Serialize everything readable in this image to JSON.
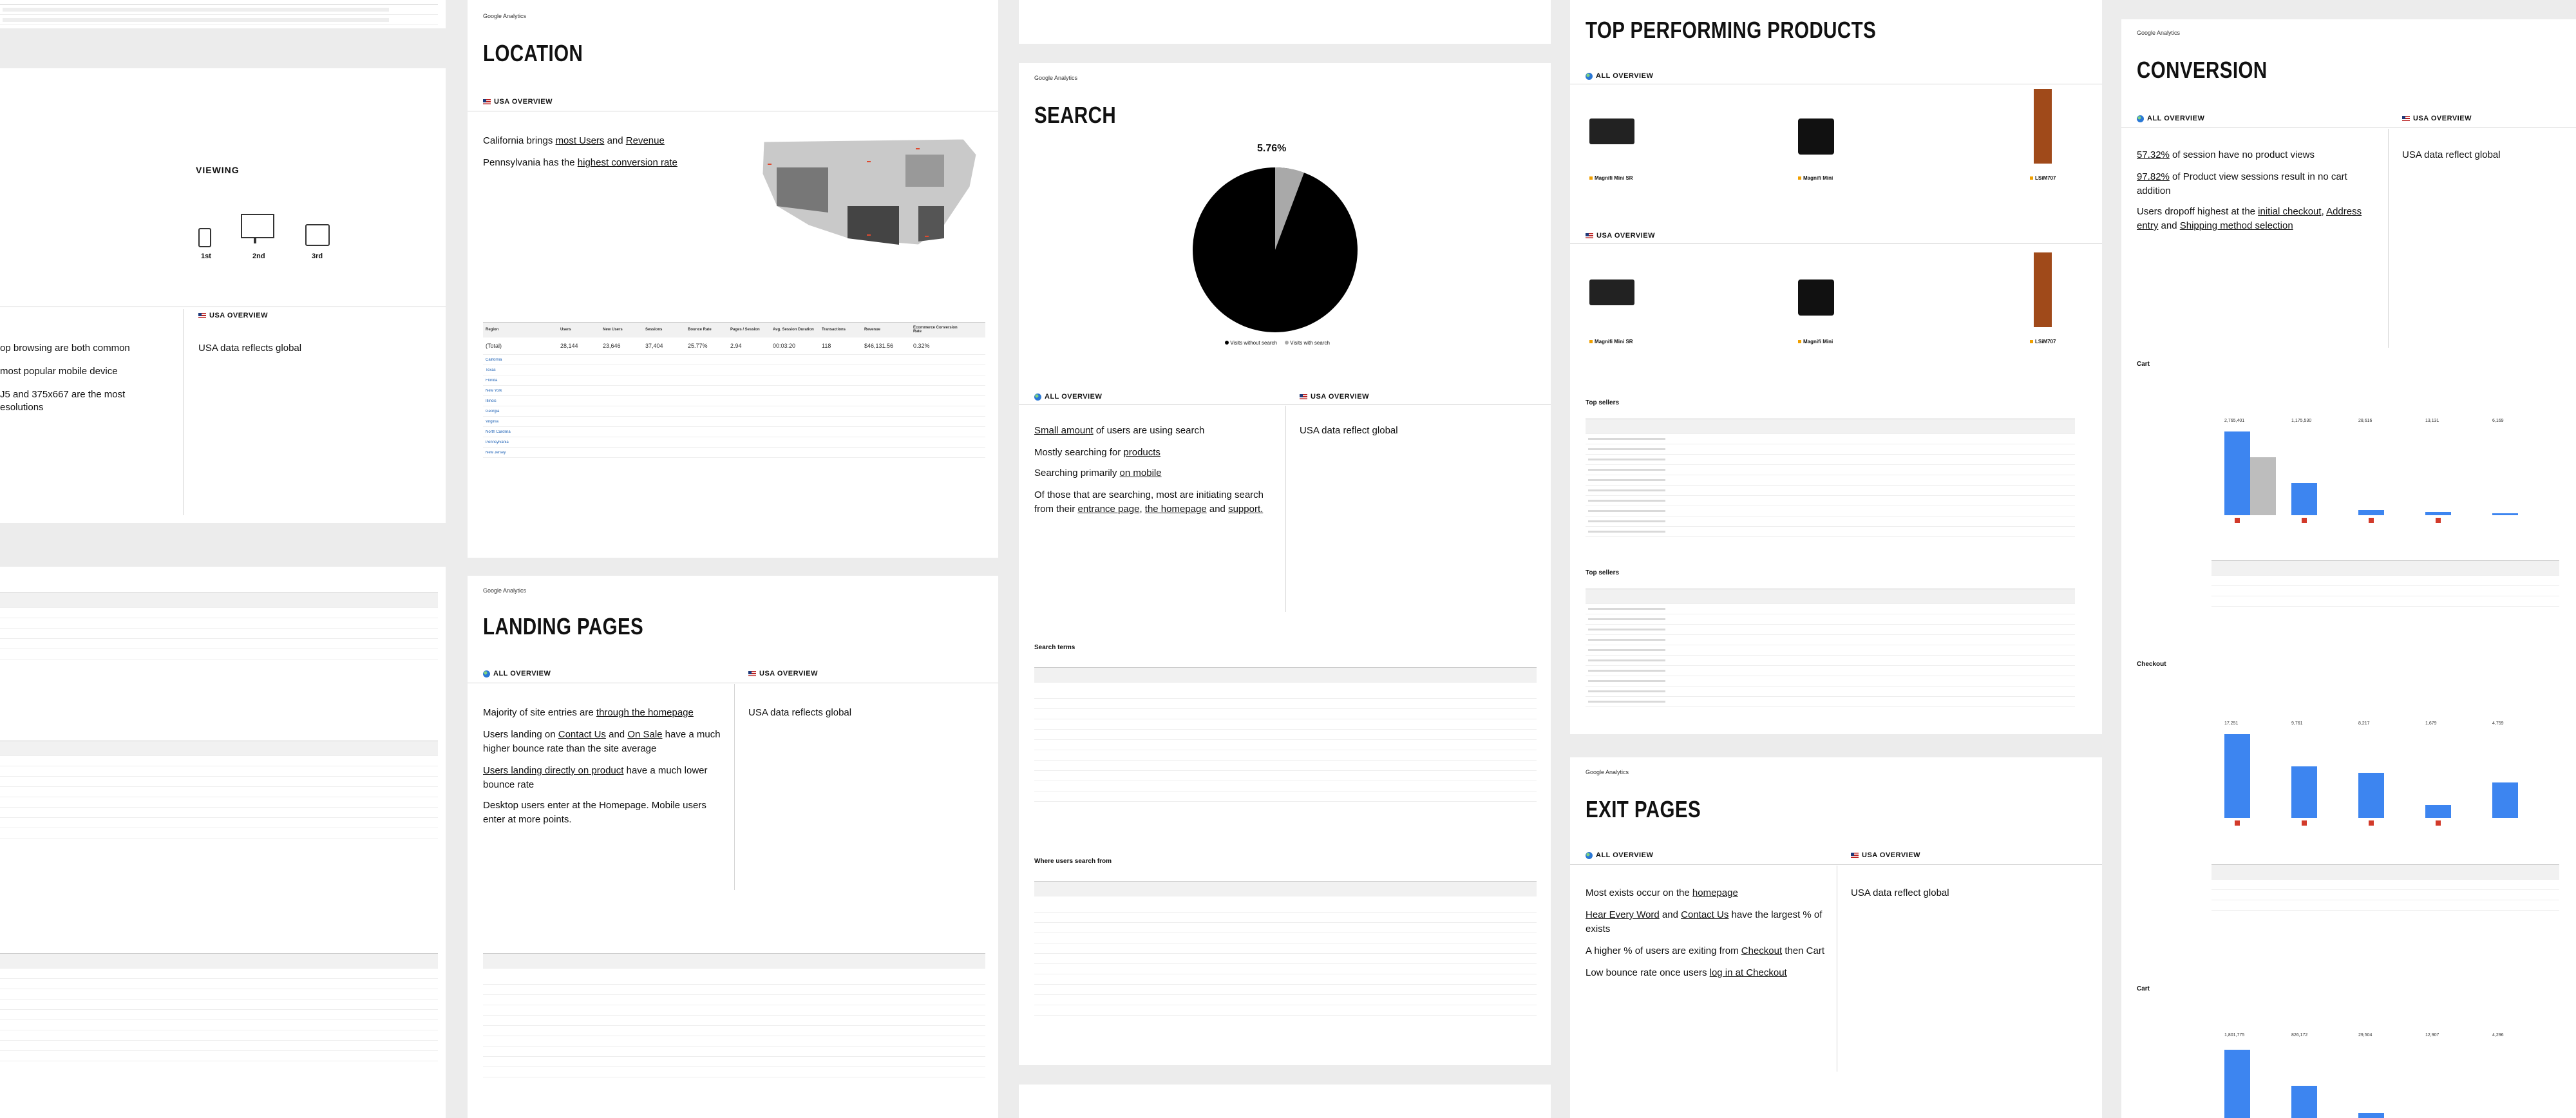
{
  "brand": "Google Analytics",
  "viewing": {
    "title": "VIEWING",
    "ranks": [
      "1st",
      "2nd",
      "3rd"
    ],
    "usa_title": "USA OVERVIEW",
    "usa_text": "USA data reflects global",
    "left_lines": [
      "op browsing are both common",
      "most popular mobile device",
      "J5 and 375x667 are the most",
      "esolutions"
    ]
  },
  "location": {
    "title": "LOCATION",
    "usa_title": "USA OVERVIEW",
    "line1_pre": "California brings ",
    "line1_a": "most Users",
    "line1_mid": " and ",
    "line1_b": "Revenue",
    "line2_pre": "Pennsylvania has the ",
    "line2_a": "highest conversion rate",
    "table_totals": [
      "28,144",
      "23,646",
      "37,404",
      "25.77%",
      "2.94",
      "00:03:20",
      "118",
      "$46,131.56",
      "0.32%"
    ],
    "table_headers": [
      "Region",
      "Users",
      "New Users",
      "Sessions",
      "Bounce Rate",
      "Pages / Session",
      "Avg. Session Duration",
      "Transactions",
      "Revenue",
      "Ecommerce Conversion Rate"
    ],
    "regions": [
      "California",
      "Texas",
      "Florida",
      "New York",
      "Illinois",
      "Georgia",
      "Virginia",
      "North Carolina",
      "Pennsylvania",
      "New Jersey"
    ],
    "totals_label": "(Total)"
  },
  "search": {
    "title": "SEARCH",
    "pie_label": "5.76%",
    "legend": [
      "Visits without search",
      "Visits with search"
    ],
    "overview_title": "ALL OVERVIEW",
    "usa_title": "USA OVERVIEW",
    "usa_text": "USA data reflect global",
    "l1_a": "Small amount",
    "l1_b": " of users are using search",
    "l2_pre": "Mostly searching for ",
    "l2_a": "products",
    "l3_pre": "Searching primarily ",
    "l3_a": "on mobile",
    "l4": "Of those that are searching, most are initiating search from their ",
    "l4_a": "entrance page",
    "l4_b": "the homepage",
    "l4_c": "support.",
    "terms_title": "Search terms",
    "where_title": "Where users search from"
  },
  "landing": {
    "title": "LANDING PAGES",
    "overview_title": "ALL OVERVIEW",
    "usa_title": "USA OVERVIEW",
    "usa_text": "USA data reflects global",
    "p1_pre": "Majority of site entries are ",
    "p1_a": "through the homepage",
    "p2_pre": "Users landing on ",
    "p2_a": "Contact Us",
    "p2_mid": " and ",
    "p2_b": "On Sale",
    "p2_post": " have a much higher bounce rate than the site average",
    "p3_a": "Users landing directly on product",
    "p3_post": " have a much lower bounce rate",
    "p4": "Desktop users enter at the Homepage. Mobile users enter at more points."
  },
  "top_products": {
    "title": "TOP PERFORMING PRODUCTS",
    "overview_title": "ALL OVERVIEW",
    "usa_title": "USA OVERVIEW",
    "products": [
      "Magnifi Mini SR",
      "Magnifi Mini",
      "LSiM707"
    ],
    "top_sellers": "Top sellers"
  },
  "exit": {
    "title": "EXIT PAGES",
    "overview_title": "ALL OVERVIEW",
    "usa_title": "USA OVERVIEW",
    "usa_text": "USA data reflect global",
    "e1_pre": "Most exists occur on the ",
    "e1_a": "homepage",
    "e2_a": "Hear Every Word",
    "e2_mid": " and ",
    "e2_b": "Contact Us",
    "e2_post": " have the largest % of exists",
    "e3_pre": "A higher % of users are exiting from ",
    "e3_a": "Checkout",
    "e3_post": " then Cart",
    "e4_pre": "Low bounce rate once users ",
    "e4_a": "log in at Checkout"
  },
  "conversion": {
    "title": "CONVERSION",
    "overview_title": "ALL OVERVIEW",
    "usa_title": "USA OVERVIEW",
    "usa_text": "USA data reflect global",
    "c1_a": "57.32%",
    "c1_post": " of session have no product views",
    "c2_a": "97.82%",
    "c2_post": " of Product view sessions result in no cart addition",
    "c3_pre": "Users dropoff highest at the ",
    "c3_a": "initial checkout",
    "c3_mid": ", ",
    "c3_b": "Address entry",
    "c3_and": " and ",
    "c3_c": "Shipping method selection",
    "cart": "Cart",
    "checkout": "Checkout",
    "cart2": "Cart",
    "cart_stats": [
      "2,765,401",
      "1,175,530",
      "28,616",
      "13,131",
      "6,169"
    ],
    "checkout_stats": [
      "17,251",
      "9,761",
      "8,217",
      "1,679",
      "4,759"
    ],
    "cart2_stats": [
      "1,801,775",
      "826,172",
      "29,504",
      "12,907",
      "4,296"
    ]
  },
  "colors": {
    "accent": "#3d85f0",
    "drop": "#d23a2a",
    "link": "#1a5fb4"
  }
}
